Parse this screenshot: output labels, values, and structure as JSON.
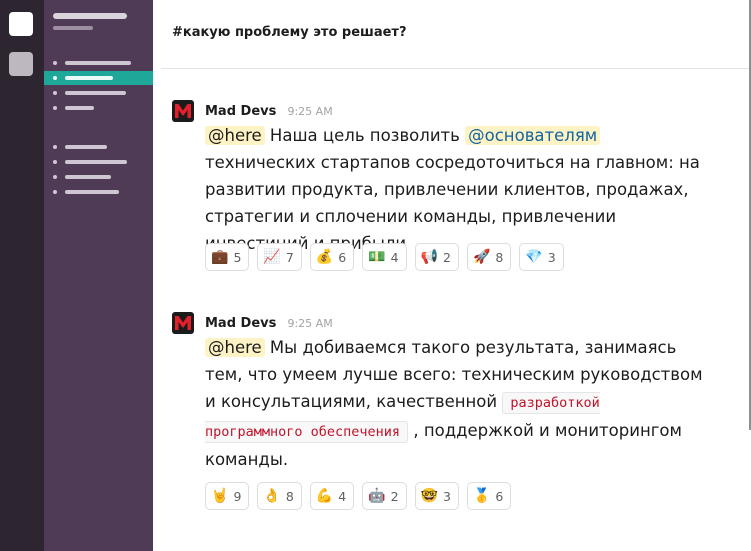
{
  "header": {
    "channel_name": "#какую проблему это решает?"
  },
  "messages": [
    {
      "author": "Mad Devs",
      "time": "9:25 AM",
      "mention_here": "@here",
      "text_1": " Наша цель позволить ",
      "mention_channel": "@основателям",
      "text_2": " технических стартапов сосредоточиться на главном: на развитии продукта, привлечении клиентов, продажах, стратегии и сплочении команды, привлечении инвестиций и прибыли",
      "reactions": [
        {
          "emoji": "💼",
          "icon": "briefcase-icon",
          "count": "5"
        },
        {
          "emoji": "📈",
          "icon": "chart-increasing-icon",
          "count": "7"
        },
        {
          "emoji": "💰",
          "icon": "money-bag-icon",
          "count": "6"
        },
        {
          "emoji": "💵",
          "icon": "dollar-banknote-icon",
          "count": "4"
        },
        {
          "emoji": "📢",
          "icon": "loudspeaker-icon",
          "count": "2"
        },
        {
          "emoji": "🚀",
          "icon": "rocket-icon",
          "count": "8"
        },
        {
          "emoji": "💎",
          "icon": "gem-stone-icon",
          "count": "3"
        }
      ]
    },
    {
      "author": "Mad Devs",
      "time": "9:25 AM",
      "mention_here": "@here",
      "text_1": " Мы добиваемся такого результата, занимаясь тем, что умеем лучше всего: техническим руководством и консультациями, качественной ",
      "code": "разработкой программного обеспечения",
      "text_2": " , поддержкой и мониторингом команды.",
      "reactions": [
        {
          "emoji": "🤘",
          "icon": "sign-of-horns-icon",
          "count": "9"
        },
        {
          "emoji": "👌",
          "icon": "ok-hand-icon",
          "count": "8"
        },
        {
          "emoji": "💪",
          "icon": "flexed-biceps-icon",
          "count": "4"
        },
        {
          "emoji": "🤖",
          "icon": "robot-icon",
          "count": "2"
        },
        {
          "emoji": "🤓",
          "icon": "nerd-face-icon",
          "count": "3"
        },
        {
          "emoji": "🥇",
          "icon": "first-place-medal-icon",
          "count": "6"
        }
      ]
    }
  ],
  "colors": {
    "rail": "#2d2530",
    "sidebar": "#4f3b55",
    "sidebar_active": "#1da89a",
    "mention_bg": "#fef3c4",
    "mention_link": "#1264a3",
    "code_text": "#c0142b",
    "avatar_logo": "#e0202b"
  }
}
